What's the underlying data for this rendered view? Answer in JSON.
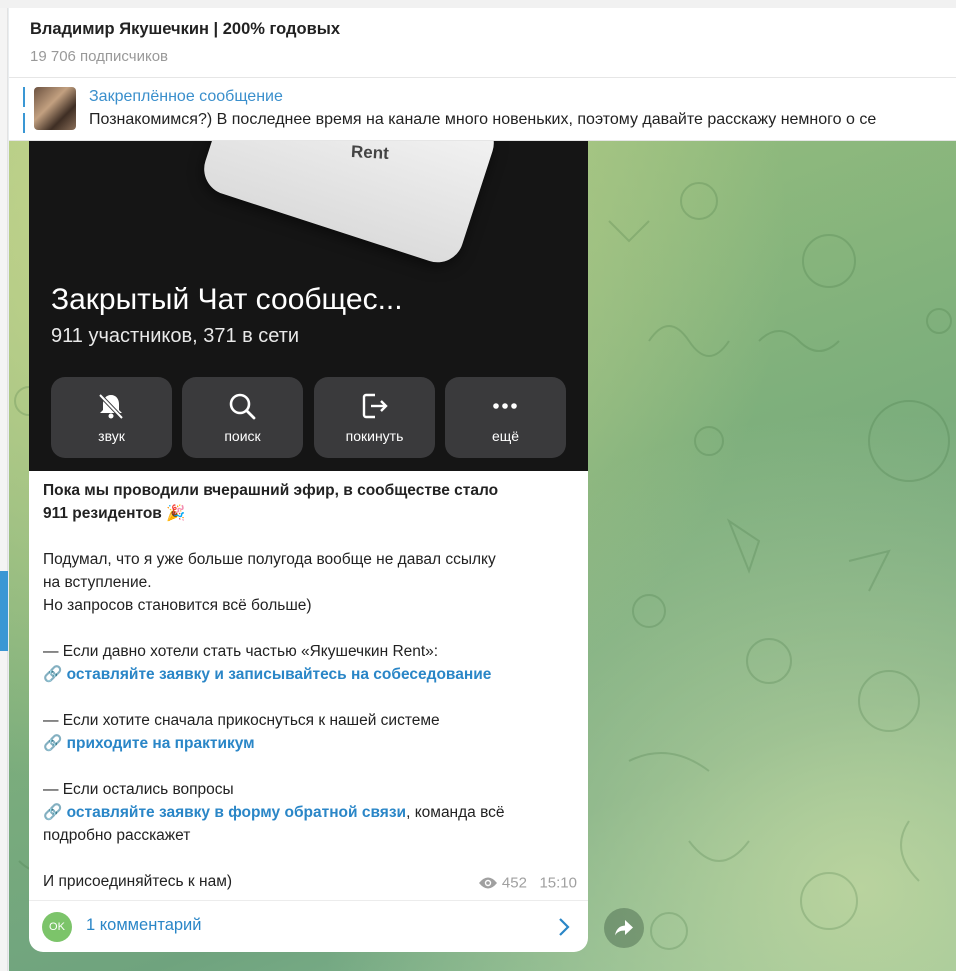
{
  "channel": {
    "title": "Владимир Якушечкин | 200% годовых",
    "subscribers": "19 706 подписчиков"
  },
  "pinned": {
    "label": "Закреплённое сообщение",
    "text": "Познакомимся?)  В последнее время на канале много новеньких, поэтому давайте расскажу немного о се"
  },
  "media": {
    "device_label": "Rent",
    "chat_title": "Закрытый Чат сообщес...",
    "chat_subtitle": "911 участников, 371 в сети",
    "buttons": [
      {
        "label": "звук",
        "icon": "bell-off-icon"
      },
      {
        "label": "поиск",
        "icon": "search-icon"
      },
      {
        "label": "покинуть",
        "icon": "leave-icon"
      },
      {
        "label": "ещё",
        "icon": "more-icon"
      }
    ]
  },
  "message": {
    "line1": "Пока мы проводили вчерашний эфир, в сообществе стало",
    "line2": "911 резидентов",
    "p2_line1": "Подумал, что я уже больше полугода вообще не давал ссылку",
    "p2_line2": "на вступление.",
    "p2_line3": "Но запросов становится всё больше)",
    "b1_text": "— Если давно хотели стать частью «Якушечкин Rent»:",
    "b1_link": "оставляйте заявку и записывайтесь на собеседование",
    "b2_text": "— Если хотите сначала прикоснуться к нашей системе",
    "b2_link": "приходите на практикум",
    "b3_text": "— Если остались вопросы",
    "b3_link": "оставляйте заявку в форму обратной связи",
    "b3_tail": ", команда всё",
    "b3_tail2": "подробно расскажет",
    "closing": "И присоединяйтесь к нам)",
    "views": "452",
    "time": "15:10"
  },
  "comments": {
    "avatar": "OK",
    "label": "1 комментарий"
  },
  "colors": {
    "accent": "#2a86c7",
    "media_bg": "#151515",
    "button_bg": "#3a3a3c"
  }
}
